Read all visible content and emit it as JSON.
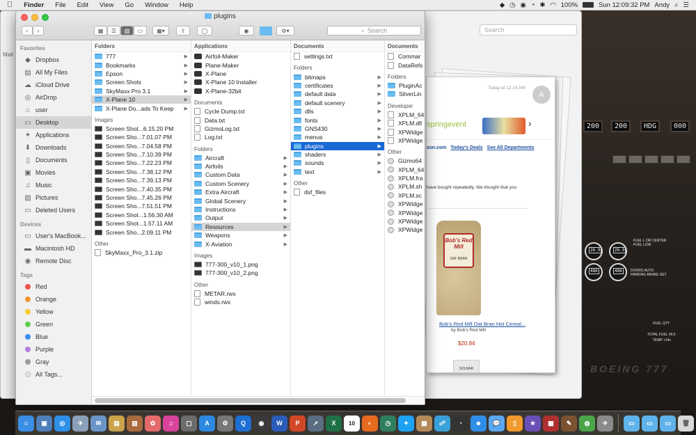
{
  "menubar": {
    "apple": "",
    "items": [
      "Finder",
      "File",
      "Edit",
      "View",
      "Go",
      "Window",
      "Help"
    ],
    "battery": "100%",
    "clock": "Sun 12:09:32 PM",
    "user": "Andy"
  },
  "finder": {
    "title": "plugins",
    "search_placeholder": "Search",
    "sidebar": {
      "favorites_heading": "Favorites",
      "favorites": [
        {
          "label": "Dropbox",
          "icon": "dropbox-icon"
        },
        {
          "label": "All My Files",
          "icon": "all-files-icon"
        },
        {
          "label": "iCloud Drive",
          "icon": "cloud-icon"
        },
        {
          "label": "AirDrop",
          "icon": "airdrop-icon"
        },
        {
          "label": "user",
          "icon": "home-icon"
        },
        {
          "label": "Desktop",
          "icon": "desktop-icon"
        },
        {
          "label": "Applications",
          "icon": "applications-icon"
        },
        {
          "label": "Downloads",
          "icon": "downloads-icon"
        },
        {
          "label": "Documents",
          "icon": "documents-icon"
        },
        {
          "label": "Movies",
          "icon": "movies-icon"
        },
        {
          "label": "Music",
          "icon": "music-icon"
        },
        {
          "label": "Pictures",
          "icon": "pictures-icon"
        },
        {
          "label": "Deleted Users",
          "icon": "folder-icon"
        }
      ],
      "devices_heading": "Devices",
      "devices": [
        {
          "label": "User's MacBook...",
          "icon": "laptop-icon"
        },
        {
          "label": "Macintosh HD",
          "icon": "hard-drive-icon"
        },
        {
          "label": "Remote Disc",
          "icon": "disc-icon"
        }
      ],
      "tags_heading": "Tags",
      "tags": [
        {
          "label": "Red",
          "color": "#f2534b"
        },
        {
          "label": "Orange",
          "color": "#f7962c"
        },
        {
          "label": "Yellow",
          "color": "#f5cc2f"
        },
        {
          "label": "Green",
          "color": "#5dcc52"
        },
        {
          "label": "Blue",
          "color": "#3b8ef5"
        },
        {
          "label": "Purple",
          "color": "#b57ee0"
        },
        {
          "label": "Gray",
          "color": "#9b9b9b"
        },
        {
          "label": "All Tags...",
          "color": "#e2e2e2"
        }
      ]
    },
    "col1": {
      "folders_heading": "Folders",
      "folders": [
        "777",
        "Bookmarks",
        "Epson",
        "Screen Shots",
        "SkyMaxx Pro 3.1",
        "X-Plane 10",
        "X-Plane Do...ads To Keep"
      ],
      "images_heading": "Images",
      "images": [
        "Screen Shot...6.15.20 PM",
        "Screen Sho...7.01.07 PM",
        "Screen Sho...7.04.58 PM",
        "Screen Sho...7.10.39 PM",
        "Screen Sho...7.22.23 PM",
        "Screen Sho...7.38.12 PM",
        "Screen Sho...7.39.13 PM",
        "Screen Sho...7.40.35 PM",
        "Screen Sho...7.45.26 PM",
        "Screen Sho...7.51.51 PM",
        "Screen Shot...1.56.30 AM",
        "Screen Shot...1.57.11 AM",
        "Screen Sho...2.09.11 PM"
      ],
      "other_heading": "Other",
      "other": [
        "SkyMaxx_Pro_3.1.zip"
      ]
    },
    "col2": {
      "applications_heading": "Applications",
      "applications": [
        "Airfoil-Maker",
        "Plane-Maker",
        "X-Plane",
        "X-Plane 10 Installer",
        "X-Plane-32bit"
      ],
      "documents_heading": "Documents",
      "documents": [
        "Cycle Dump.txt",
        "Data.txt",
        "GizmoLog.txt",
        "Log.txt"
      ],
      "folders_heading": "Folders",
      "folders": [
        "Aircraft",
        "Airfoils",
        "Custom Data",
        "Custom Scenery",
        "Extra Aircraft",
        "Global Scenery",
        "Instructions",
        "Output",
        "Resources",
        "Weapons",
        "X-Aviation"
      ],
      "images_heading": "Images",
      "images": [
        "777-300_v10_1.png",
        "777-300_v10_2.png"
      ],
      "other_heading": "Other",
      "other": [
        "METAR.rwx",
        "winds.rwx"
      ]
    },
    "col3": {
      "documents_heading": "Documents",
      "documents": [
        "settings.txt"
      ],
      "folders_heading": "Folders",
      "folders": [
        "bitmaps",
        "certificates",
        "default data",
        "default scenery",
        "dlls",
        "fonts",
        "GNS430",
        "menus",
        "plugins",
        "shaders",
        "sounds",
        "text"
      ],
      "other_heading": "Other",
      "other": [
        "dsf_files"
      ]
    },
    "col4": {
      "documents_heading": "Documents",
      "documents": [
        "Commar",
        "DataRefs"
      ],
      "folders_heading": "Folders",
      "folders": [
        "PluginAc",
        "SilverLin"
      ],
      "developer_heading": "Developer",
      "developer": [
        "XPLM_64",
        "XPLM.dll",
        "XPWidge",
        "XPWidge"
      ],
      "other_heading": "Other",
      "other": [
        "Gizmo64",
        "XPLM_64",
        "XPLM.fra",
        "XPLM.sh",
        "XPLM.sc",
        "XPWidge",
        "XPWidge",
        "XPWidge",
        "XPWidge"
      ]
    }
  },
  "back_window": {
    "search_placeholder": "Search"
  },
  "email": {
    "time": "Today at 12:14 AM",
    "avatar": "A",
    "banner_text": "springevent",
    "links": [
      "zon.com",
      "Today's Deals",
      "See All Departments"
    ],
    "body_text": "have bought repeatedly. We thought that you",
    "product_title": "Bob's Red Mill Oat Bran Hot Cereal...",
    "product_by": "by Bob's Red Mill",
    "price": "$20.84",
    "bag_brand": "Bob's Red Mill",
    "bag_label": "OAT BRAN",
    "footer_logo": "SOLBAR"
  },
  "cockpit": {
    "displays": [
      "200",
      "200",
      "HDG",
      "000"
    ],
    "gauges": [
      "26.9",
      "26.9",
      "486",
      "486"
    ],
    "labels": [
      "FUEL L OR CENTER",
      "FUEL LOW",
      "DOORS AUTO",
      "PARKING BRAKE SET",
      "FUEL QTY",
      "TOTAL FUEL 40.0",
      "TEMP +14c"
    ],
    "brand": "BOEING 777"
  },
  "dock": {
    "apps": [
      {
        "name": "finder-icon",
        "color": "#3a8ee6",
        "glyph": "☺"
      },
      {
        "name": "preview-icon",
        "color": "#4d7fb8",
        "glyph": "▣"
      },
      {
        "name": "safari-icon",
        "color": "#2f8fe8",
        "glyph": "◎"
      },
      {
        "name": "photos-browser-icon",
        "color": "#8aa0b8",
        "glyph": "✈"
      },
      {
        "name": "mail-icon",
        "color": "#6b95c7",
        "glyph": "✉"
      },
      {
        "name": "notes-icon",
        "color": "#c9a24a",
        "glyph": "▤"
      },
      {
        "name": "contacts-icon",
        "color": "#a86a3c",
        "glyph": "▥"
      },
      {
        "name": "photos-icon",
        "color": "#e36b6b",
        "glyph": "✿"
      },
      {
        "name": "itunes-icon",
        "color": "#d9439b",
        "glyph": "♫"
      },
      {
        "name": "textedit-icon",
        "color": "#6c6c6c",
        "glyph": "▢"
      },
      {
        "name": "app-store-icon",
        "color": "#2b8ae0",
        "glyph": "A"
      },
      {
        "name": "system-preferences-icon",
        "color": "#777",
        "glyph": "⚙"
      },
      {
        "name": "quicktime-icon",
        "color": "#1d6fd1",
        "glyph": "Q"
      },
      {
        "name": "camera-icon",
        "color": "#3a3a3a",
        "glyph": "◉"
      },
      {
        "name": "word-icon",
        "color": "#2b5cb8",
        "glyph": "W"
      },
      {
        "name": "powerpoint-icon",
        "color": "#d24726",
        "glyph": "P"
      },
      {
        "name": "launchpad-icon",
        "color": "#5b6d80",
        "glyph": "➚"
      },
      {
        "name": "excel-icon",
        "color": "#1e7145",
        "glyph": "X"
      },
      {
        "name": "calendar-icon",
        "color": "#ffffff",
        "glyph": "10"
      },
      {
        "name": "firefox-icon",
        "color": "#e66a1f",
        "glyph": "◐"
      },
      {
        "name": "time-machine-icon",
        "color": "#2f7f5f",
        "glyph": "◷"
      },
      {
        "name": "twitter-icon",
        "color": "#1da1f2",
        "glyph": "✦"
      },
      {
        "name": "archive-icon",
        "color": "#b48a5a",
        "glyph": "▦"
      },
      {
        "name": "network-icon",
        "color": "#3aa0d8",
        "glyph": "☍"
      },
      {
        "name": "dashboard-icon",
        "color": "#333",
        "glyph": "◔"
      },
      {
        "name": "screen-sharing-icon",
        "color": "#2f8fe8",
        "glyph": "☻"
      },
      {
        "name": "messages-icon",
        "color": "#5aa7f0",
        "glyph": "💬"
      },
      {
        "name": "ibooks-icon",
        "color": "#f09a2f",
        "glyph": "▯"
      },
      {
        "name": "imovie-icon",
        "color": "#6a4fb8",
        "glyph": "★"
      },
      {
        "name": "photo-booth-icon",
        "color": "#b03030",
        "glyph": "▩"
      },
      {
        "name": "utility-icon",
        "color": "#7a5230",
        "glyph": "✎"
      },
      {
        "name": "maps-icon",
        "color": "#4aa54a",
        "glyph": "◍"
      },
      {
        "name": "xplane-icon",
        "color": "#8a8a8a",
        "glyph": "✈"
      }
    ],
    "folders": [
      {
        "name": "applications-folder-icon",
        "color": "#5fb3ea",
        "glyph": "▭"
      },
      {
        "name": "documents-folder-icon",
        "color": "#5fb3ea",
        "glyph": "▭"
      },
      {
        "name": "downloads-folder-icon",
        "color": "#5fb3ea",
        "glyph": "▭"
      },
      {
        "name": "trash-icon",
        "color": "#d8d8d8",
        "glyph": "🗑"
      }
    ]
  }
}
